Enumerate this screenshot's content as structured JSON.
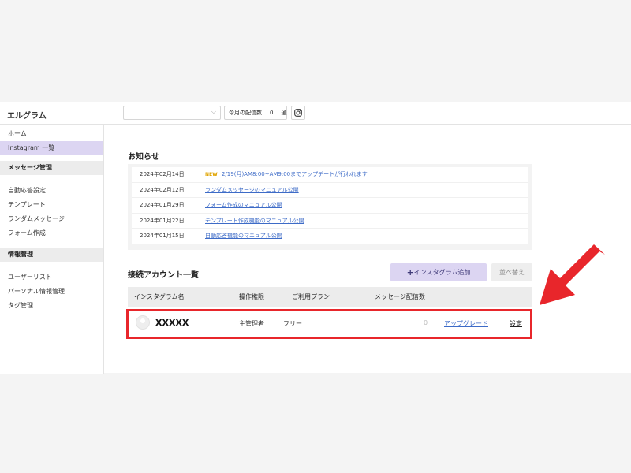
{
  "brand": "エルグラム",
  "topbar": {
    "monthly_label": "今月の配信数",
    "monthly_count": "0",
    "monthly_unit": "通"
  },
  "sidebar": {
    "items": [
      {
        "label": "ホーム"
      },
      {
        "label": "Instagram 一覧"
      }
    ],
    "section_messages": "メッセージ管理",
    "message_items": [
      {
        "label": "自動応答設定"
      },
      {
        "label": "テンプレート"
      },
      {
        "label": "ランダムメッセージ"
      },
      {
        "label": "フォーム作成"
      }
    ],
    "section_info": "情報管理",
    "info_items": [
      {
        "label": "ユーザーリスト"
      },
      {
        "label": "パーソナル情報管理"
      },
      {
        "label": "タグ管理"
      }
    ]
  },
  "news": {
    "title": "お知らせ",
    "new_badge": "NEW",
    "items": [
      {
        "date": "2024年02月14日",
        "text": "2/19(月)AM8:00~AM9:00までアップデートが行われます"
      },
      {
        "date": "2024年02月12日",
        "text": "ランダムメッセージのマニュアル公開"
      },
      {
        "date": "2024年01月29日",
        "text": "フォーム作成のマニュアル公開"
      },
      {
        "date": "2024年01月22日",
        "text": "テンプレート作成機能のマニュアル公開"
      },
      {
        "date": "2024年01月15日",
        "text": "自動応答機能のマニュアル公開"
      }
    ]
  },
  "accounts": {
    "title": "接続アカウント一覧",
    "add_button": "インスタグラム追加",
    "sort_button": "並べ替え",
    "columns": [
      "インスタグラム名",
      "操作権限",
      "ご利用プラン",
      "メッセージ配信数"
    ],
    "rows": [
      {
        "name": "XXXXX",
        "role": "主管理者",
        "plan": "フリー",
        "count": "0",
        "upgrade": "アップグレード",
        "settings": "設定"
      }
    ]
  },
  "colors": {
    "accent_purple": "#dcd5f2",
    "highlight_red": "#e8262b",
    "link_blue": "#3d6bc7"
  }
}
